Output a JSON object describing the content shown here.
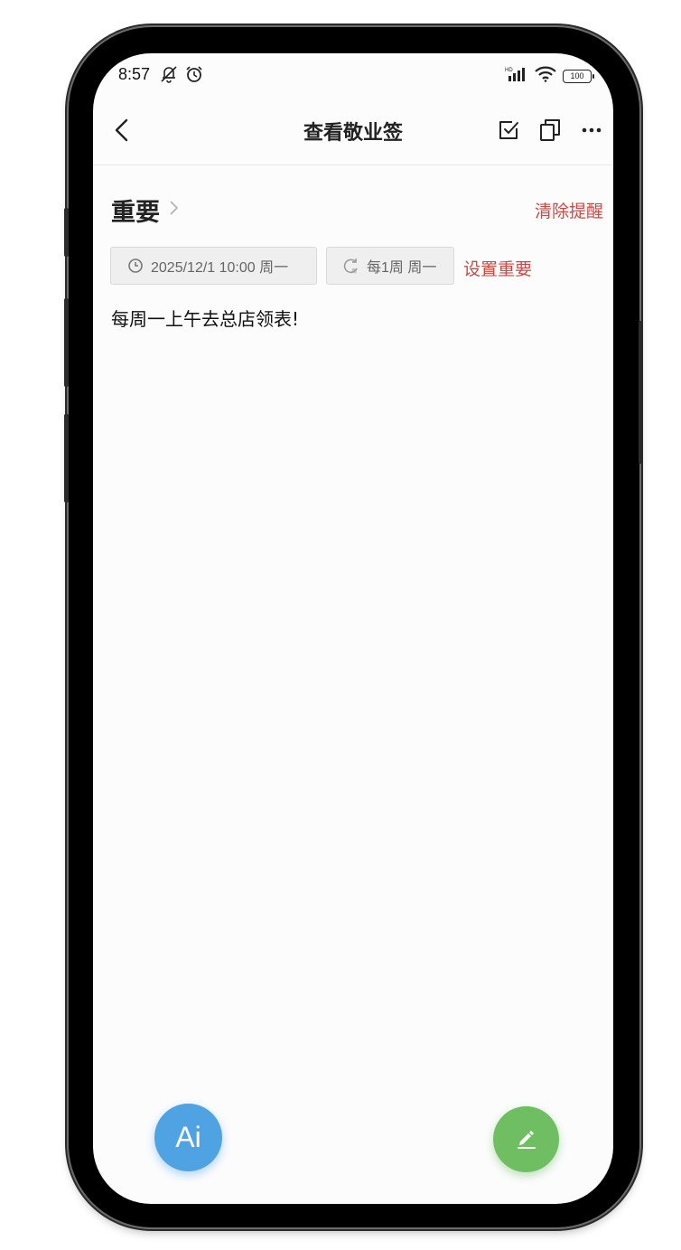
{
  "status_bar": {
    "time": "8:57",
    "battery": "100",
    "icons": [
      "silent-notification-icon",
      "alarm-icon",
      "hd-signal-icon",
      "wifi-icon",
      "battery-icon"
    ]
  },
  "nav": {
    "title": "查看敬业签",
    "icons": [
      "back-arrow-icon",
      "checkbox-icon",
      "copy-icon",
      "more-icon"
    ]
  },
  "section": {
    "title": "重要",
    "clear_reminder": "清除提醒"
  },
  "reminder": {
    "datetime": "2025/12/1 10:00 周一",
    "repeat": "每1周 周一",
    "set_important": "设置重要"
  },
  "note": {
    "content": "每周一上午去总店领表!"
  },
  "fab": {
    "ai_label": "Ai",
    "ai_color": "#4fa3e3",
    "edit_color": "#6fbf62"
  },
  "colors": {
    "accent_red": "#c94a45"
  }
}
